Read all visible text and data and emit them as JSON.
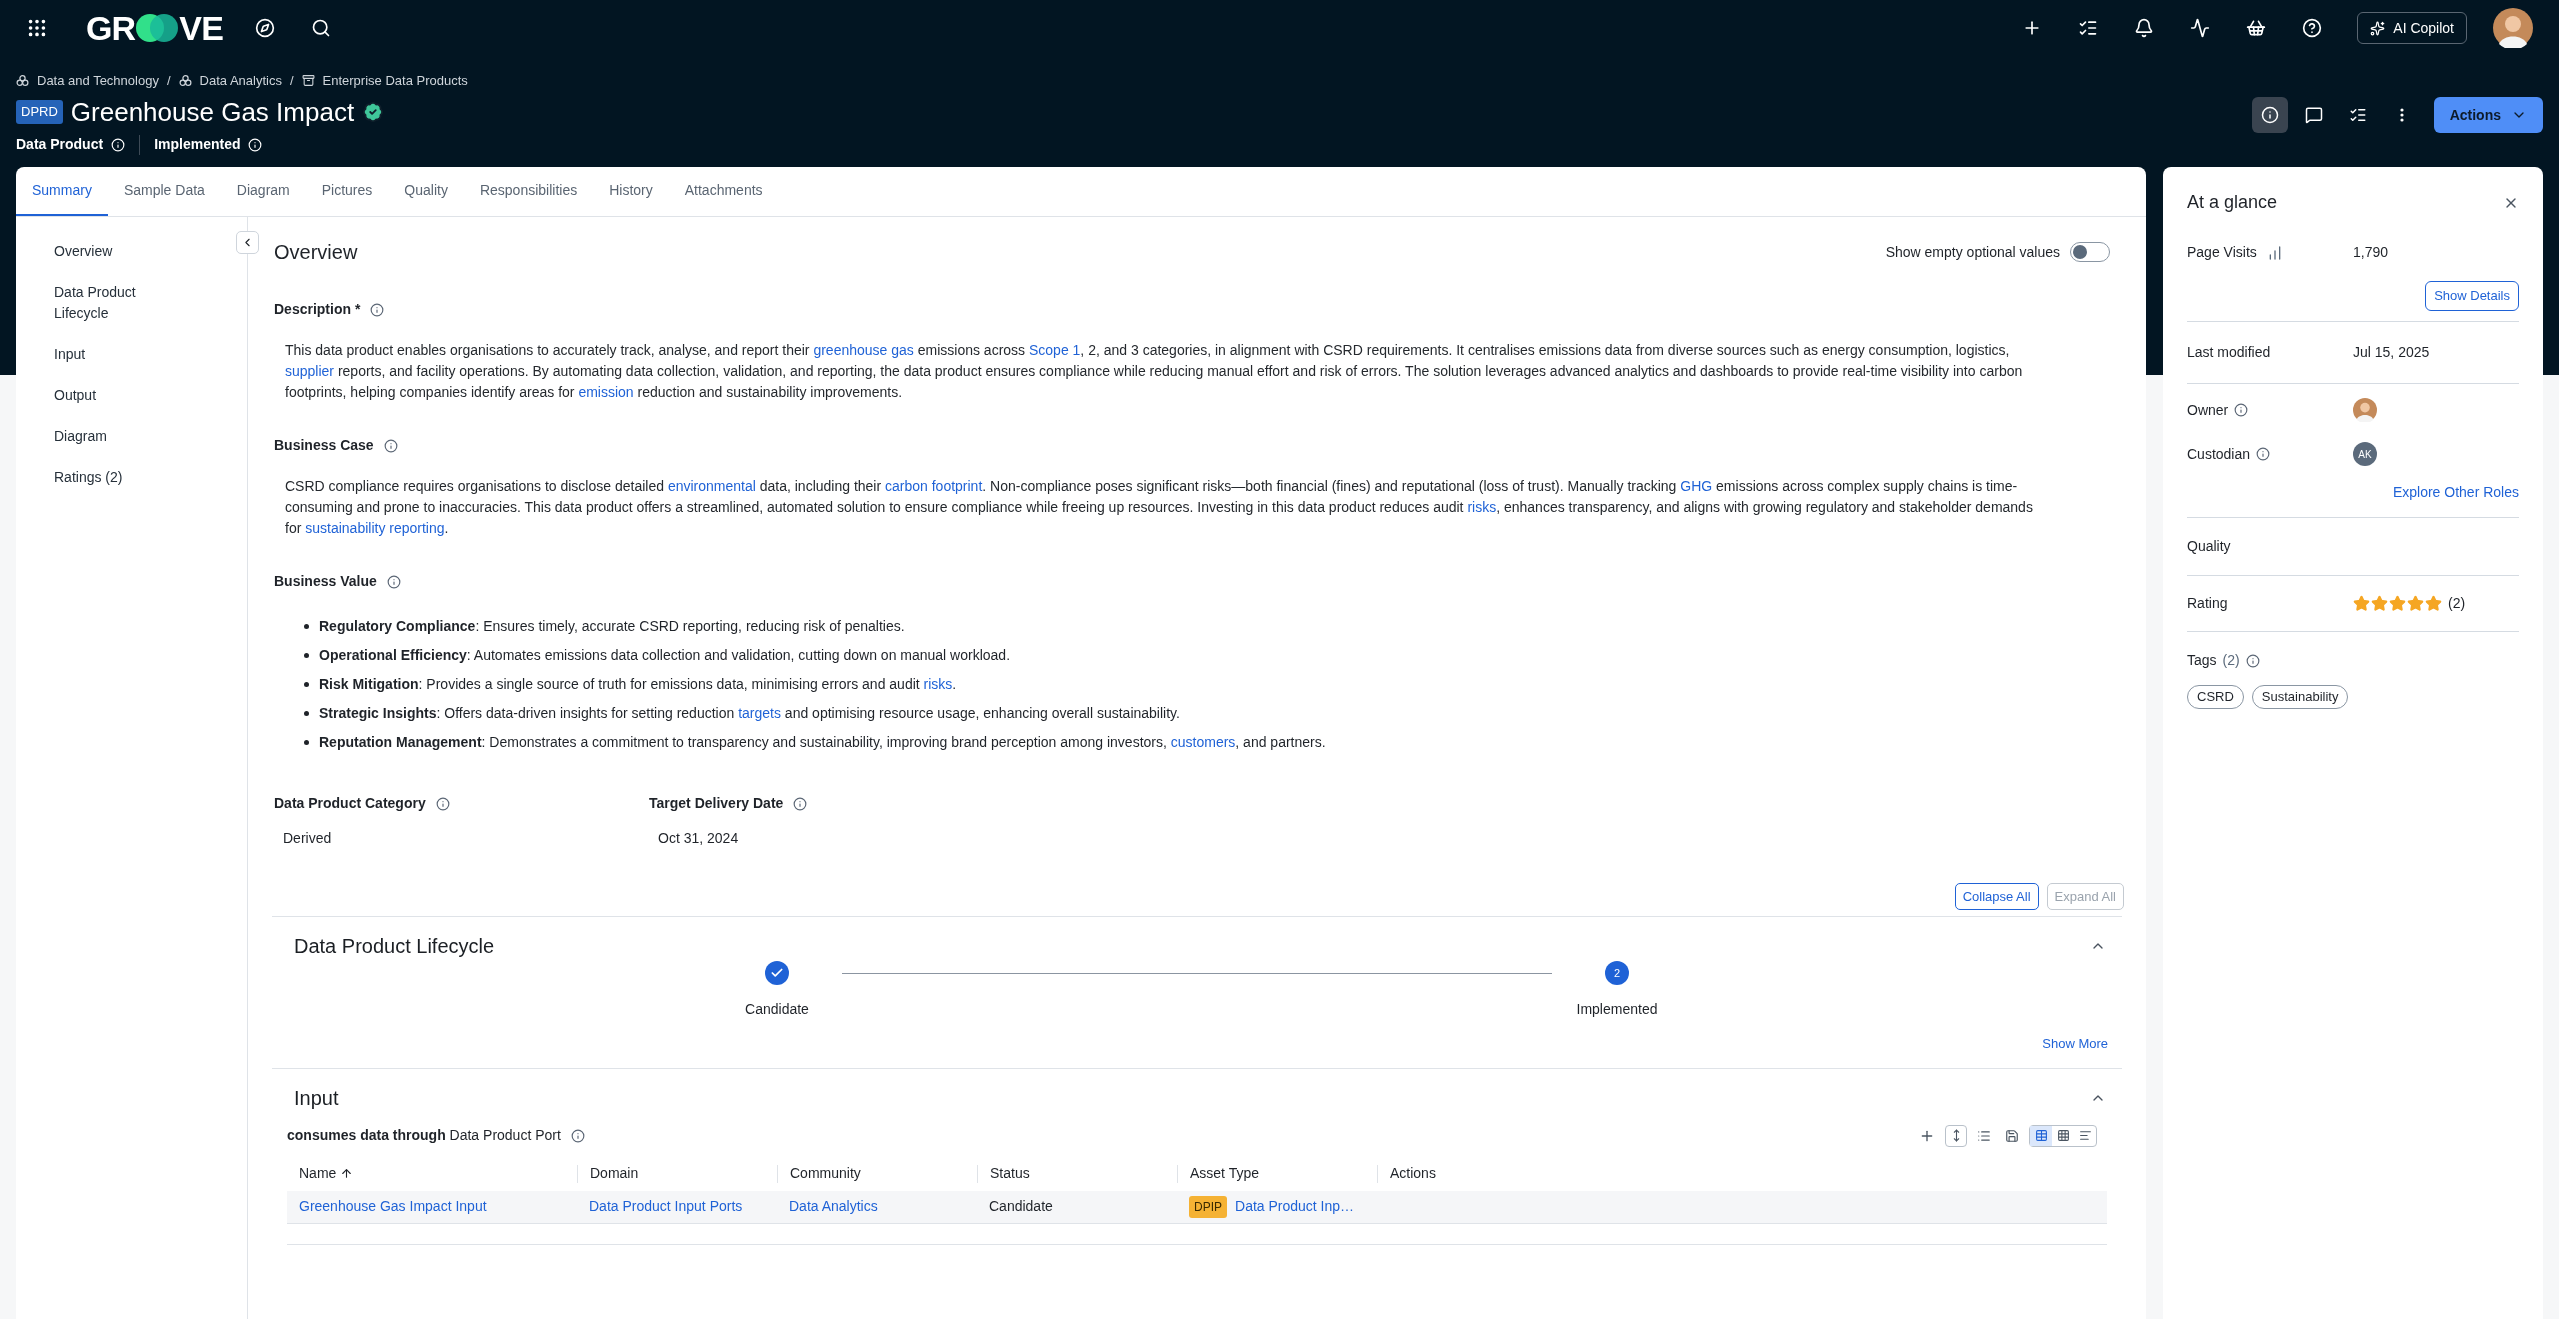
{
  "top_bar": {
    "logo_left": "GR",
    "logo_right": "VE",
    "copilot": "AI Copilot"
  },
  "breadcrumb_separator": "/",
  "breadcrumbs": [
    {
      "label": "Data and Technology",
      "kind": "community"
    },
    {
      "label": "Data Analytics",
      "kind": "community"
    },
    {
      "label": "Enterprise Data Products",
      "kind": "domain"
    }
  ],
  "asset": {
    "badge": "DPRD",
    "title": "Greenhouse Gas Impact",
    "verified": true,
    "type": "Data Product",
    "status": "Implemented"
  },
  "header_actions": {
    "info_active": true,
    "actions_button": "Actions"
  },
  "tabs": [
    {
      "label": "Summary",
      "selected": true
    },
    {
      "label": "Sample Data",
      "selected": false
    },
    {
      "label": "Diagram",
      "selected": false
    },
    {
      "label": "Pictures",
      "selected": false
    },
    {
      "label": "Quality",
      "selected": false
    },
    {
      "label": "Responsibilities",
      "selected": false
    },
    {
      "label": "History",
      "selected": false
    },
    {
      "label": "Attachments",
      "selected": false
    }
  ],
  "side_nav": [
    "Overview",
    "Data Product Lifecycle",
    "Input",
    "Output",
    "Diagram",
    "Ratings (2)"
  ],
  "overview": {
    "title": "Overview",
    "toggle_label": "Show empty optional values",
    "toggle_on": false,
    "description": {
      "label": "Description *",
      "segments": [
        {
          "kind": "text",
          "text": "This data product enables organisations to accurately track, analyse, and report their "
        },
        {
          "kind": "link",
          "text": "greenhouse gas"
        },
        {
          "kind": "text",
          "text": " emissions across "
        },
        {
          "kind": "link",
          "text": "Scope 1"
        },
        {
          "kind": "text",
          "text": ", 2, and 3 categories, in alignment with CSRD requirements. It centralises emissions data from diverse sources such as energy consumption, logistics, "
        },
        {
          "kind": "link",
          "text": "supplier"
        },
        {
          "kind": "text",
          "text": " reports, and facility operations. By automating data collection, validation, and reporting, the data product ensures compliance while reducing manual effort and risk of errors. The solution leverages advanced analytics and dashboards to provide real-time visibility into carbon footprints, helping companies identify areas for "
        },
        {
          "kind": "link",
          "text": "emission"
        },
        {
          "kind": "text",
          "text": " reduction and sustainability improvements."
        }
      ]
    },
    "business_case": {
      "label": "Business Case",
      "segments": [
        {
          "kind": "text",
          "text": "CSRD compliance requires organisations to disclose detailed "
        },
        {
          "kind": "link",
          "text": "environmental"
        },
        {
          "kind": "text",
          "text": " data, including their "
        },
        {
          "kind": "link",
          "text": "carbon footprint"
        },
        {
          "kind": "text",
          "text": ". Non-compliance poses significant risks—both financial (fines) and reputational (loss of trust). Manually tracking "
        },
        {
          "kind": "link",
          "text": "GHG"
        },
        {
          "kind": "text",
          "text": " emissions across complex supply chains is time-consuming and prone to inaccuracies. This data product offers a streamlined, automated solution to ensure compliance while freeing up resources. Investing in this data product reduces audit "
        },
        {
          "kind": "link",
          "text": "risks"
        },
        {
          "kind": "text",
          "text": ", enhances transparency, and aligns with growing regulatory and stakeholder demands for "
        },
        {
          "kind": "link",
          "text": "sustainability reporting"
        },
        {
          "kind": "text",
          "text": "."
        }
      ]
    },
    "business_value": {
      "label": "Business Value",
      "bullets": [
        [
          {
            "kind": "text",
            "text": "**Regulatory Compliance**: Ensures timely, accurate CSRD reporting, reducing risk of penalties."
          }
        ],
        [
          {
            "kind": "text",
            "text": "**Operational Efficiency**: Automates emissions data collection and validation, cutting down on manual workload."
          }
        ],
        [
          {
            "kind": "text",
            "text": "**Risk Mitigation**: Provides a single source of truth for emissions data, minimising errors and audit "
          },
          {
            "kind": "link",
            "text": "risks"
          },
          {
            "kind": "text",
            "text": "."
          }
        ],
        [
          {
            "kind": "text",
            "text": "**Strategic Insights**: Offers data-driven insights for setting reduction "
          },
          {
            "kind": "link",
            "text": "targets"
          },
          {
            "kind": "text",
            "text": " and optimising resource usage, enhancing overall sustainability."
          }
        ],
        [
          {
            "kind": "text",
            "text": "**Reputation Management**: Demonstrates a commitment to transparency and sustainability, improving brand perception among investors, "
          },
          {
            "kind": "link",
            "text": "customers"
          },
          {
            "kind": "text",
            "text": ", and partners."
          }
        ]
      ]
    },
    "fields": [
      {
        "label": "Data Product Category",
        "value": "Derived"
      },
      {
        "label": "Target Delivery Date",
        "value": "Oct 31, 2024"
      }
    ],
    "collapse_all": {
      "label": "Collapse All",
      "disabled": false
    },
    "expand_all": {
      "label": "Expand All",
      "disabled": true
    }
  },
  "lifecycle": {
    "title": "Data Product Lifecycle",
    "expanded": true,
    "steps": [
      {
        "kind": "done",
        "label": "Candidate"
      },
      {
        "kind": "current",
        "number": "2",
        "label": "Implemented"
      }
    ],
    "show_more": "Show More"
  },
  "input": {
    "title": "Input",
    "expanded": true,
    "subtitle": "**consumes data through** Data Product Port",
    "views": [
      {
        "kind": "table",
        "selected": true
      },
      {
        "kind": "tiles",
        "selected": false
      },
      {
        "kind": "list",
        "selected": false
      }
    ],
    "columns": [
      {
        "label": "Name",
        "sorted": true
      },
      {
        "label": "Domain",
        "sorted": false
      },
      {
        "label": "Community",
        "sorted": false
      },
      {
        "label": "Status",
        "sorted": false
      },
      {
        "label": "Asset Type",
        "sorted": false
      },
      {
        "label": "Actions",
        "sorted": false
      }
    ],
    "rows": [
      [
        {
          "kind": "link",
          "text": "Greenhouse Gas Impact Input"
        },
        {
          "kind": "link",
          "text": "Data Product Input Ports"
        },
        {
          "kind": "link",
          "text": "Data Analytics"
        },
        {
          "kind": "text",
          "text": "Candidate"
        },
        {
          "kind": "asset",
          "badge": "DPIP",
          "text": "Data Product Inp…"
        }
      ]
    ]
  },
  "glance": {
    "title": "At a glance",
    "page_visits_label": "Page Visits",
    "page_visits": "1,790",
    "show_details": "Show Details",
    "last_modified_label": "Last modified",
    "last_modified": "Jul 15, 2025",
    "roles": [
      {
        "label": "Owner",
        "kind": "photo"
      },
      {
        "label": "Custodian",
        "kind": "initials",
        "initials": "AK"
      }
    ],
    "explore": "Explore Other Roles",
    "quality_label": "Quality",
    "rating_label": "Rating",
    "stars": 5,
    "rating_count": "(2)",
    "tags_label": "Tags",
    "tags_count": "(2)",
    "tags": [
      "CSRD",
      "Sustainability"
    ]
  }
}
